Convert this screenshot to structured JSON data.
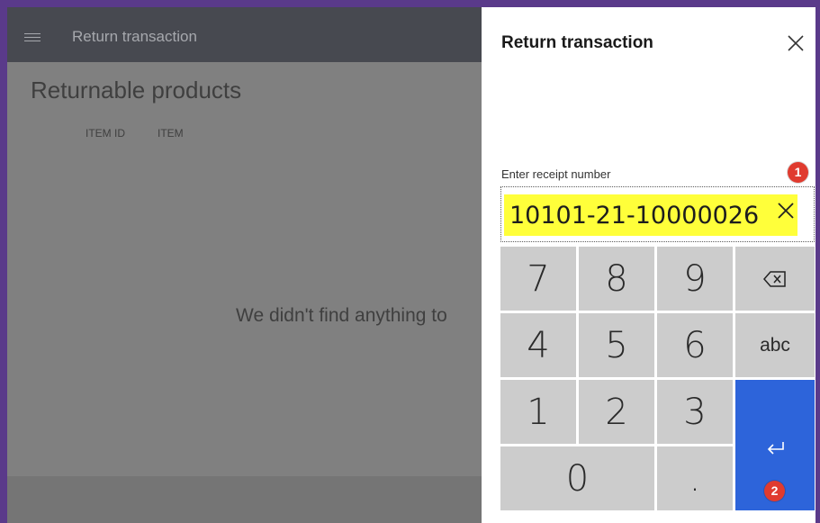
{
  "app": {
    "header_title": "Return transaction",
    "section_title": "Returnable products",
    "columns": [
      "ITEM ID",
      "ITEM"
    ],
    "empty_message": "We didn't find anything to"
  },
  "panel": {
    "title": "Return transaction",
    "field_label": "Enter receipt number",
    "receipt_value": "10101-21-10000026",
    "keys": {
      "seven": "7",
      "eight": "8",
      "nine": "9",
      "four": "4",
      "five": "5",
      "six": "6",
      "one": "1",
      "two": "2",
      "three": "3",
      "zero": "0",
      "dot": ".",
      "abc": "abc"
    }
  },
  "badges": {
    "first": "1",
    "second": "2"
  },
  "colors": {
    "input_highlight": "#ffff3a",
    "enter_key": "#2d64da",
    "badge": "#e03b2f",
    "header": "#474950"
  },
  "icons": [
    "hamburger-icon",
    "close-icon",
    "clear-icon",
    "backspace-icon",
    "enter-icon"
  ]
}
